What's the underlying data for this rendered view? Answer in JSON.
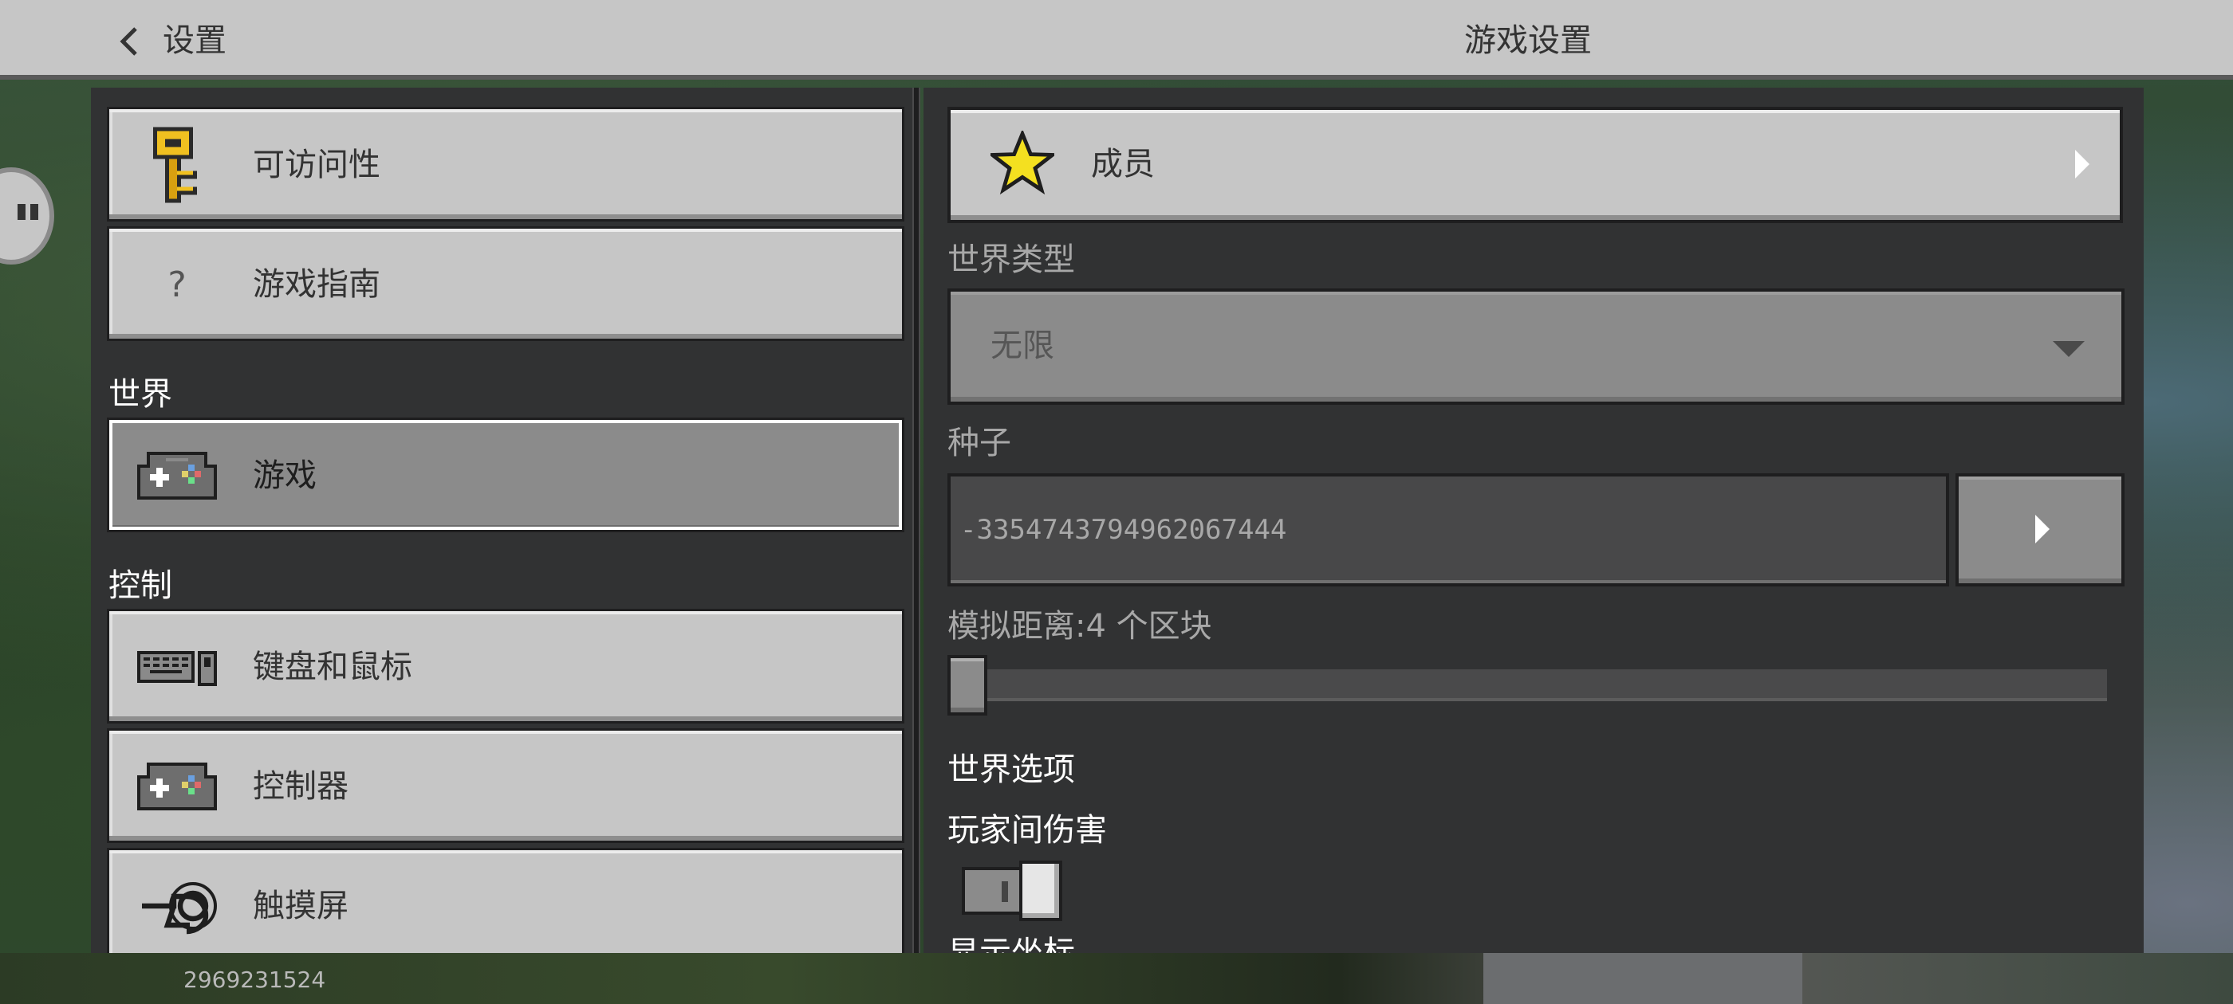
{
  "header": {
    "back_label": "设置",
    "title": "游戏设置"
  },
  "left_nav": {
    "items_top": [
      {
        "label": "可访问性",
        "icon": "key-icon"
      },
      {
        "label": "游戏指南",
        "icon": "question-icon",
        "glyph": "?"
      }
    ],
    "section_world": "世界",
    "world_items": [
      {
        "label": "游戏",
        "icon": "gamepad-icon",
        "active": true
      }
    ],
    "section_controls": "控制",
    "control_items": [
      {
        "label": "键盘和鼠标",
        "icon": "keyboard-mouse-icon"
      },
      {
        "label": "控制器",
        "icon": "gamepad-icon"
      },
      {
        "label": "触摸屏",
        "icon": "touch-hand-icon"
      }
    ]
  },
  "right": {
    "members_label": "成员",
    "world_type_label": "世界类型",
    "world_type_value": "无限",
    "seed_label": "种子",
    "seed_value": "-3354743794962067444",
    "sim_distance_label": "模拟距离:4 个区块",
    "sim_distance_value": 4,
    "world_options_heading": "世界选项",
    "pvp_label": "玩家间伤害",
    "pvp_enabled": true,
    "next_label_partial": "显示坐标"
  },
  "footer": {
    "version": "2969231524"
  },
  "colors": {
    "panel": "#313233",
    "button": "#c6c6c6",
    "button_active": "#8b8b8b",
    "header": "#c6c6c6"
  }
}
